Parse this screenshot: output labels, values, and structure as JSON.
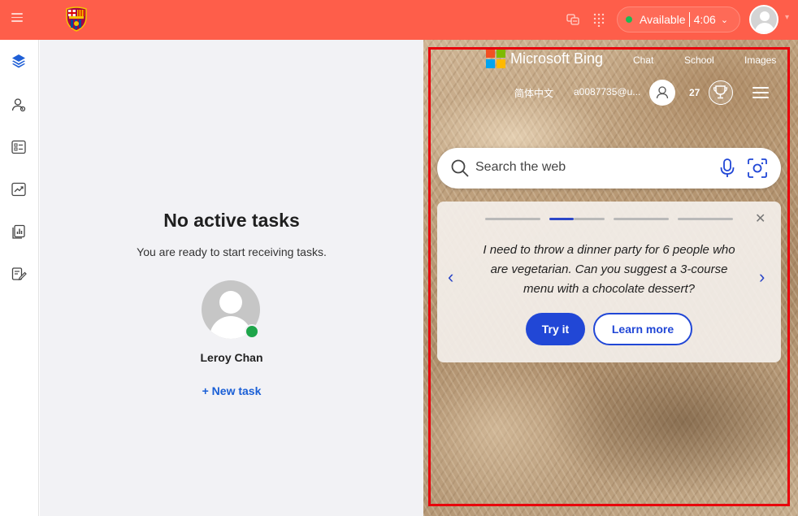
{
  "topbar": {
    "status_label": "Available",
    "timer": "4:06",
    "colors": {
      "bar": "#fe5e4a",
      "status_dot": "#1db954"
    },
    "icons": [
      "menu-icon",
      "team-crest-icon",
      "translate-icon",
      "dialpad-icon",
      "chevron-down-icon",
      "user-avatar-icon"
    ]
  },
  "sidebar": {
    "icons": [
      "layers-icon",
      "contacts-icon",
      "list-card-icon",
      "trend-chart-icon",
      "report-icon",
      "edit-note-icon"
    ]
  },
  "main": {
    "title": "No active tasks",
    "subtitle": "You are ready to start receiving tasks.",
    "user_name": "Leroy Chan",
    "new_task": "+ New task",
    "online_color": "#1ea54a"
  },
  "bing": {
    "brand": "Microsoft Bing",
    "nav": [
      "Chat",
      "School",
      "Images"
    ],
    "language": "简体中文",
    "email": "a0087735@u...",
    "points": "27",
    "search_placeholder": "Search the web",
    "card": {
      "prompt": "I need to throw a dinner party for 6 people who are vegetarian. Can you suggest a 3-course menu with a chocolate dessert?",
      "try_label": "Try it",
      "learn_label": "Learn more",
      "active_slide": 2,
      "total_slides": 4
    },
    "accent": "#2147d6"
  }
}
